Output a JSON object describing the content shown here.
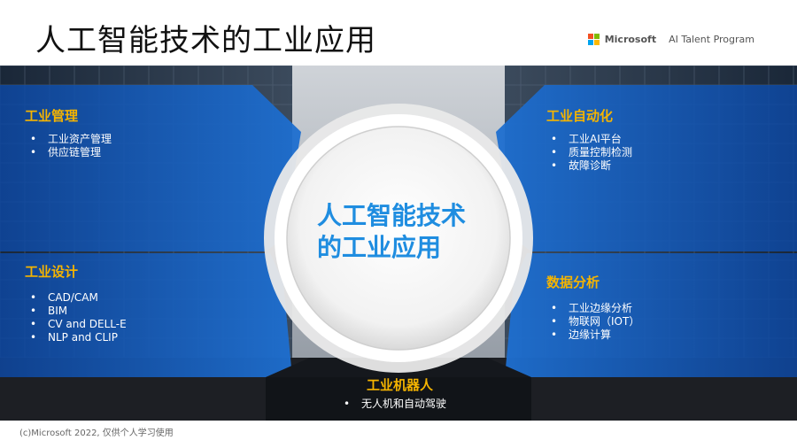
{
  "slide": {
    "title": "人工智能技术的工业应用",
    "footer": "(c)Microsoft 2022, 仅供个人学习使用"
  },
  "brand": {
    "name": "Microsoft",
    "program": "AI Talent Program",
    "logo_colors": [
      "#f25022",
      "#7fba00",
      "#00a4ef",
      "#ffb900"
    ]
  },
  "center": {
    "line1": "人工智能技术",
    "line2": "的工业应用"
  },
  "categories": {
    "management": {
      "title": "工业管理",
      "items": [
        "工业资产管理",
        "供应链管理"
      ]
    },
    "design": {
      "title": "工业设计",
      "items": [
        "CAD/CAM",
        "BIM",
        "CV and DELL-E",
        "NLP and CLIP"
      ]
    },
    "automation": {
      "title": "工业自动化",
      "items": [
        "工业AI平台",
        "质量控制检测",
        "故障诊断"
      ]
    },
    "analytics": {
      "title": "数据分析",
      "items": [
        "工业边缘分析",
        "物联网（IOT）",
        "边缘计算"
      ]
    },
    "robots": {
      "title": "工业机器人",
      "items": [
        "无人机和自动驾驶"
      ]
    }
  },
  "colors": {
    "accent_yellow": "#f5b400",
    "panel_blue": "#1565c0",
    "center_text": "#1f8de0"
  }
}
